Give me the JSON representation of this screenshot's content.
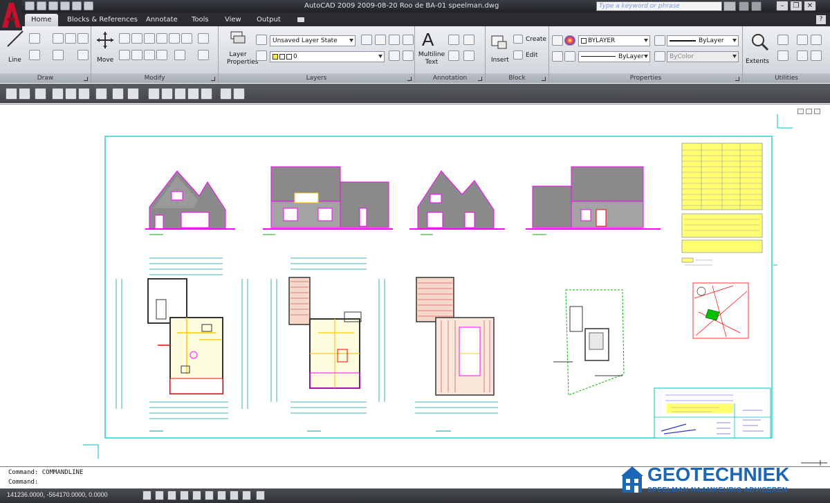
{
  "window": {
    "title": "AutoCAD 2009  2009-08-20 Roo de BA-01 speelman.dwg"
  },
  "search": {
    "placeholder": "Type a keyword or phrase"
  },
  "window_controls": {
    "minimize": "–",
    "restore": "❐",
    "close": "✕"
  },
  "help": "?",
  "tabs": [
    {
      "label": "Home",
      "active": true
    },
    {
      "label": "Blocks & References"
    },
    {
      "label": "Annotate"
    },
    {
      "label": "Tools"
    },
    {
      "label": "View"
    },
    {
      "label": "Output"
    }
  ],
  "panels": {
    "draw": {
      "title": "Draw",
      "line_label": "Line"
    },
    "modify": {
      "title": "Modify",
      "move_label": "Move"
    },
    "layers": {
      "title": "Layers",
      "layer_properties_label": "Layer Properties",
      "layer_state": "Unsaved Layer State",
      "current_layer": "0"
    },
    "annotation": {
      "title": "Annotation",
      "multiline_text_label": "Multiline Text"
    },
    "block": {
      "title": "Block",
      "insert_label": "Insert",
      "create_label": "Create",
      "edit_label": "Edit"
    },
    "properties": {
      "title": "Properties",
      "color": "BYLAYER",
      "lineweight": "ByLayer",
      "linetype": "ByLayer",
      "plot_style": "ByColor"
    },
    "utilities": {
      "title": "Utilities",
      "extents_label": "Extents"
    }
  },
  "command": {
    "line1": "Command:  COMMANDLINE",
    "line2": "Command:"
  },
  "status": {
    "coordinates": "141236.0000, -564170.0000, 0.0000"
  },
  "watermark": {
    "title": "GEOTECHNIEK",
    "subtitle": "SPEELMAN NAAMKEURIG ADVISEREN"
  },
  "colors": {
    "accent": "#1d66b5",
    "title_bar": "#2b2d32",
    "drawing_frame": "#00bfbf"
  }
}
